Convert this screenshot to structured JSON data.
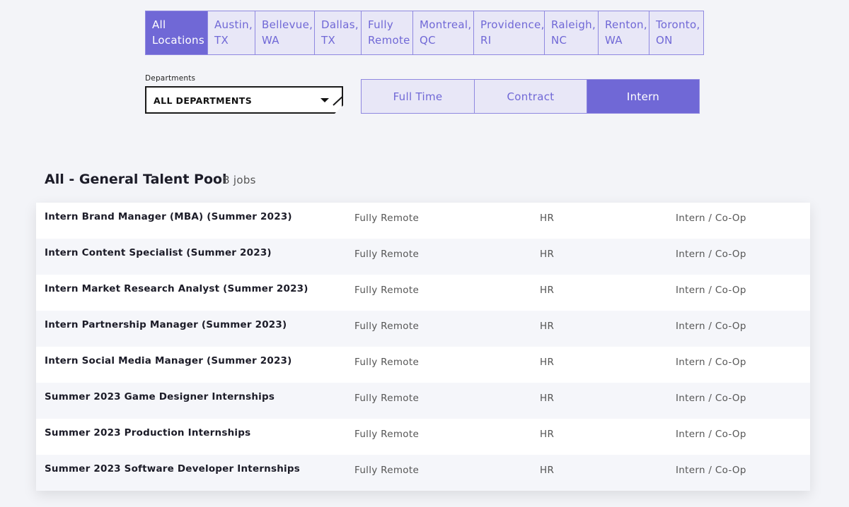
{
  "locations": [
    {
      "line1": "All",
      "line2": "Locations",
      "active": true
    },
    {
      "line1": "Austin,",
      "line2": "TX",
      "active": false
    },
    {
      "line1": "Bellevue,",
      "line2": "WA",
      "active": false
    },
    {
      "line1": "Dallas,",
      "line2": "TX",
      "active": false
    },
    {
      "line1": "Fully",
      "line2": "Remote",
      "active": false
    },
    {
      "line1": "Montreal,",
      "line2": "QC",
      "active": false
    },
    {
      "line1": "Providence,",
      "line2": "RI",
      "active": false
    },
    {
      "line1": "Raleigh,",
      "line2": "NC",
      "active": false
    },
    {
      "line1": "Renton,",
      "line2": "WA",
      "active": false
    },
    {
      "line1": "Toronto,",
      "line2": "ON",
      "active": false
    }
  ],
  "departments": {
    "label": "Departments",
    "value": "ALL DEPARTMENTS"
  },
  "job_types": [
    {
      "label": "Full Time",
      "active": false
    },
    {
      "label": "Contract",
      "active": false
    },
    {
      "label": "Intern",
      "active": true
    }
  ],
  "section": {
    "title": "All - General Talent Pool",
    "count": "8 jobs"
  },
  "jobs": [
    {
      "title": "Intern Brand Manager (MBA) (Summer 2023)",
      "location": "Fully Remote",
      "department": "HR",
      "type": "Intern / Co-Op"
    },
    {
      "title": "Intern Content Specialist (Summer 2023)",
      "location": "Fully Remote",
      "department": "HR",
      "type": "Intern / Co-Op"
    },
    {
      "title": "Intern Market Research Analyst (Summer 2023)",
      "location": "Fully Remote",
      "department": "HR",
      "type": "Intern / Co-Op"
    },
    {
      "title": "Intern Partnership Manager (Summer 2023)",
      "location": "Fully Remote",
      "department": "HR",
      "type": "Intern / Co-Op"
    },
    {
      "title": "Intern Social Media Manager (Summer 2023)",
      "location": "Fully Remote",
      "department": "HR",
      "type": "Intern / Co-Op"
    },
    {
      "title": "Summer 2023 Game Designer Internships",
      "location": "Fully Remote",
      "department": "HR",
      "type": "Intern / Co-Op"
    },
    {
      "title": "Summer 2023 Production Internships",
      "location": "Fully Remote",
      "department": "HR",
      "type": "Intern / Co-Op"
    },
    {
      "title": "Summer 2023 Software Developer Internships",
      "location": "Fully Remote",
      "department": "HR",
      "type": "Intern / Co-Op"
    }
  ],
  "colors": {
    "accent": "#7068d6",
    "tab_background": "#e8e7f7",
    "page_background": "#f3f4f8"
  }
}
